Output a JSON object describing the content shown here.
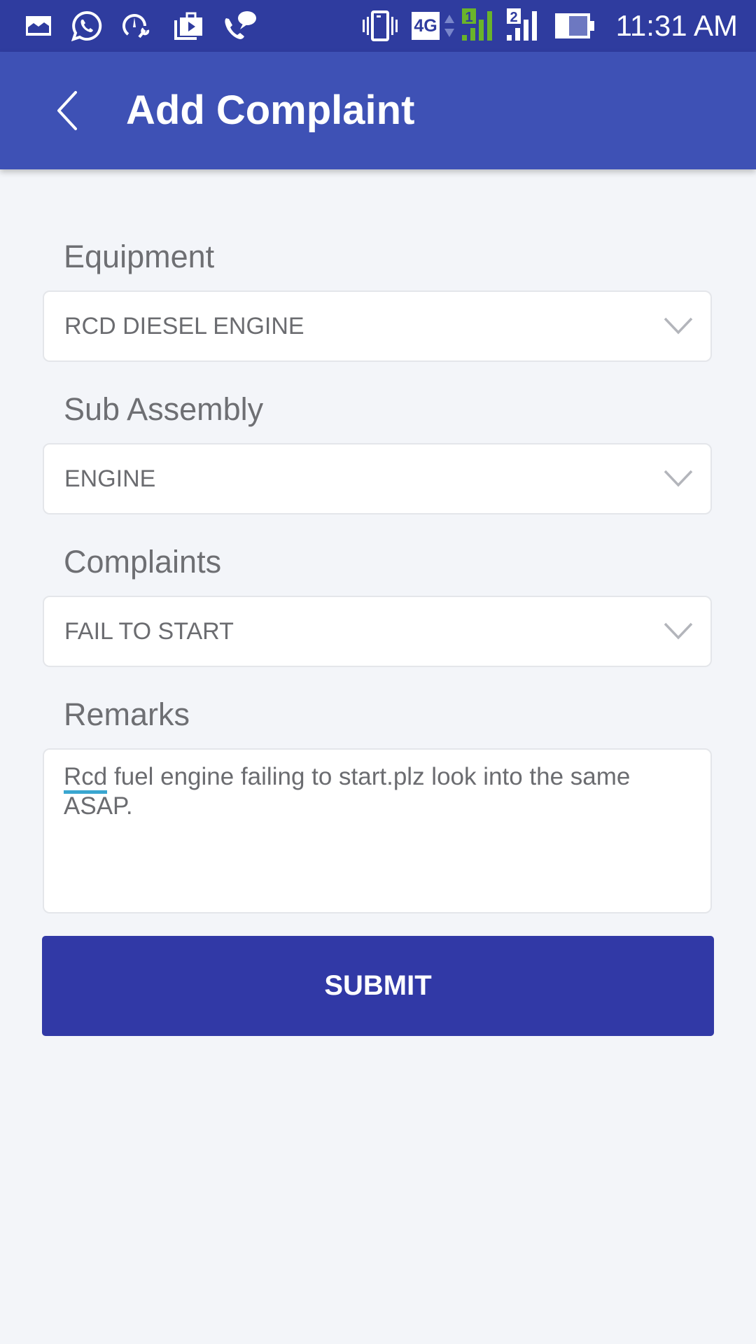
{
  "status_bar": {
    "notification_icons": [
      "gallery-icon",
      "whatsapp-icon",
      "speedometer-wrench-icon",
      "play-store-bag-icon",
      "call-message-icon"
    ],
    "system_icons": [
      "vibrate-icon",
      "network-4g-icon",
      "sim1-signal-icon",
      "sim2-signal-icon",
      "battery-icon"
    ],
    "network_label": "4G",
    "sim1_label": "1",
    "sim2_label": "2",
    "time": "11:31 AM",
    "colors": {
      "sim1_signal": "#6ab42a",
      "bar": "#2f3c9f"
    }
  },
  "app_bar": {
    "title": "Add Complaint",
    "back_icon": "chevron-left-icon",
    "color": "#3e51b5"
  },
  "form": {
    "equipment": {
      "label": "Equipment",
      "value": "RCD DIESEL ENGINE"
    },
    "sub_assembly": {
      "label": "Sub Assembly",
      "value": "ENGINE"
    },
    "complaints": {
      "label": "Complaints",
      "value": "FAIL TO START"
    },
    "remarks": {
      "label": "Remarks",
      "misspelled_word": "Rcd",
      "value_rest": " fuel engine failing to start.plz look into the same ASAP."
    },
    "submit_label": "SUBMIT",
    "submit_color": "#3139a6"
  }
}
